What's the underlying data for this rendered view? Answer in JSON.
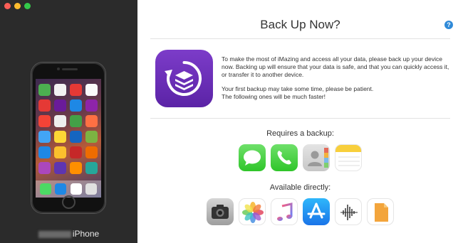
{
  "window": {
    "title": "Back Up Now?",
    "help_label": "?"
  },
  "sidebar": {
    "device_name": "iPhone"
  },
  "main": {
    "description_p1": "To make the most of iMazing and access all your data, please back up your device now. Backing up will ensure that your data is safe, and that you can quickly access it, or transfer it to another device.",
    "description_p2": "Your first backup may take some time, please be patient.\nThe following ones will be much faster!",
    "requires_backup_label": "Requires a backup:",
    "available_directly_label": "Available directly:",
    "requires_backup_apps": [
      "messages-icon",
      "phone-icon",
      "contacts-icon",
      "notes-icon"
    ],
    "available_directly_apps": [
      "camera-icon",
      "photos-icon",
      "music-icon",
      "app-store-icon",
      "voice-memos-icon",
      "files-icon"
    ]
  },
  "colors": {
    "sidebar_bg": "#2b2b2b",
    "accent_purple": "#6a2fb8",
    "help_blue": "#2f8ad8"
  }
}
